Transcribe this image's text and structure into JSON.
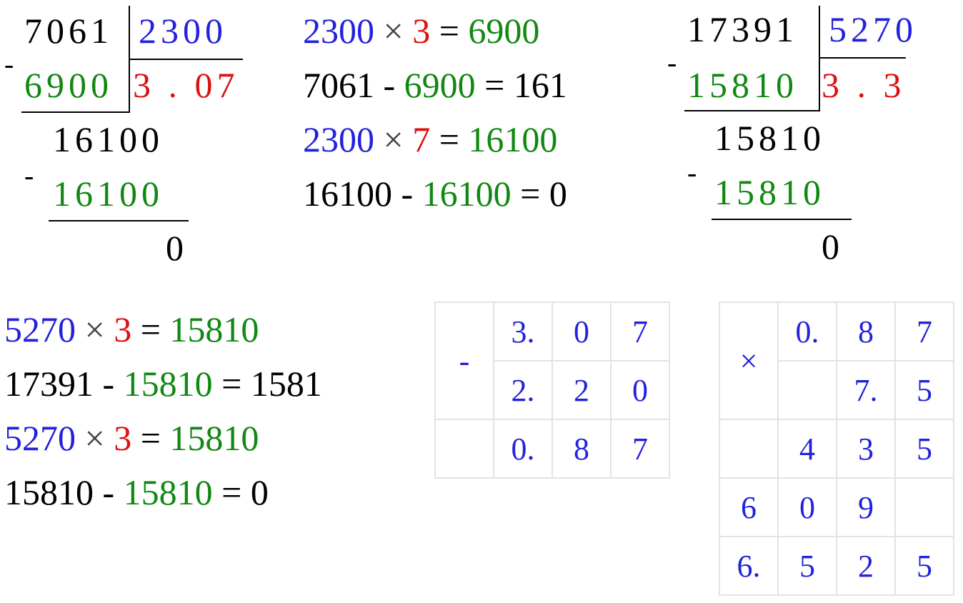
{
  "div1": {
    "dividend": "7061",
    "divisor": "2300",
    "step1_sub": "6900",
    "quotient": "3 . 07",
    "step2_dividend": "16100",
    "step2_sub": "16100",
    "remainder": "0",
    "minus": "-"
  },
  "steps1": [
    {
      "a": "2300",
      "op": "×",
      "b": "3",
      "eq": "=",
      "r": "6900"
    },
    {
      "a": "7061",
      "op": "-",
      "b": "6900",
      "eq": "=",
      "r": "161"
    },
    {
      "a": "2300",
      "op": "×",
      "b": "7",
      "eq": "=",
      "r": "16100"
    },
    {
      "a": "16100",
      "op": "-",
      "b": "16100",
      "eq": "=",
      "r": "0"
    }
  ],
  "div2": {
    "dividend": "17391",
    "divisor": "5270",
    "step1_sub": "15810",
    "quotient": "3 . 3",
    "step2_dividend": "15810",
    "step2_sub": "15810",
    "remainder": "0",
    "minus": "-"
  },
  "steps2": [
    {
      "a": "5270",
      "op": "×",
      "b": "3",
      "eq": "=",
      "r": "15810"
    },
    {
      "a": "17391",
      "op": "-",
      "b": "15810",
      "eq": "=",
      "r": "1581"
    },
    {
      "a": "5270",
      "op": "×",
      "b": "3",
      "eq": "=",
      "r": "15810"
    },
    {
      "a": "15810",
      "op": "-",
      "b": "15810",
      "eq": "=",
      "r": "0"
    }
  ],
  "subtraction_table": {
    "op": "-",
    "rows": [
      [
        "3.",
        "0",
        "7"
      ],
      [
        "2.",
        "2",
        "0"
      ],
      [
        "0.",
        "8",
        "7"
      ]
    ]
  },
  "multiplication_table": {
    "op": "×",
    "rows": [
      [
        "0.",
        "8",
        "7"
      ],
      [
        "",
        "7.",
        "5"
      ],
      [
        "",
        "4",
        "3",
        "5"
      ],
      [
        "6",
        "0",
        "9",
        ""
      ],
      [
        "6.",
        "5",
        "2",
        "5"
      ]
    ]
  },
  "colors": {
    "dividend": "#000000",
    "divisor": "#2222dd",
    "quotient": "#dd1111",
    "product": "#118811"
  }
}
